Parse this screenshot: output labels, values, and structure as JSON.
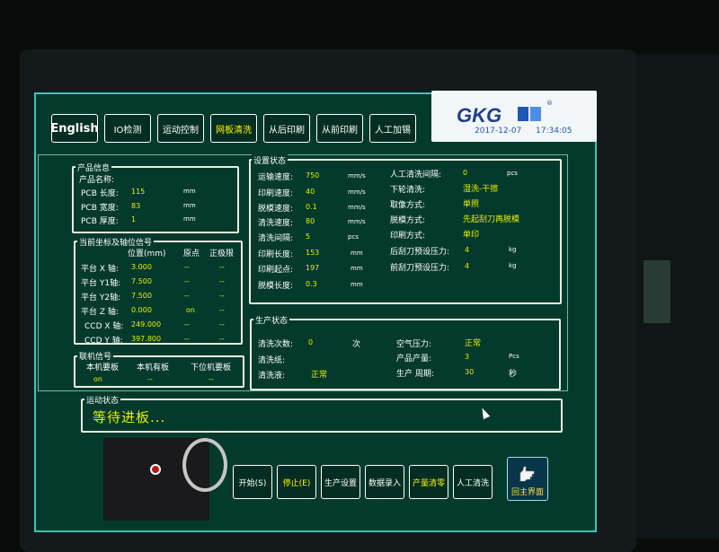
{
  "header": {
    "buttons": [
      {
        "label": "English"
      },
      {
        "label": "IO检测"
      },
      {
        "label": "运动控制"
      },
      {
        "label": "网板清洗"
      },
      {
        "label": "从后印刷"
      },
      {
        "label": "从前印刷"
      },
      {
        "label": "人工加锡"
      }
    ],
    "brand": {
      "name": "GKG",
      "reg": "®",
      "date": "2017-12-07",
      "time": "17:34:05"
    }
  },
  "product_info": {
    "title": "产品信息",
    "name_label": "产品名称:",
    "rows": [
      {
        "label": "PCB 长度:",
        "value": "115",
        "unit": "mm"
      },
      {
        "label": "PCB 宽度:",
        "value": "83",
        "unit": "mm"
      },
      {
        "label": "PCB 厚度:",
        "value": "1",
        "unit": "mm"
      }
    ]
  },
  "axis_status": {
    "title": "当前坐标及轴位信号",
    "headers": [
      "位置(mm)",
      "原点",
      "正极限"
    ],
    "rows": [
      {
        "label": "平台 X 轴:",
        "pos": "3.000",
        "origin": "--",
        "limit": "--"
      },
      {
        "label": "平台 Y1轴:",
        "pos": "7.500",
        "origin": "--",
        "limit": "--"
      },
      {
        "label": "平台 Y2轴:",
        "pos": "7.500",
        "origin": "--",
        "limit": "--"
      },
      {
        "label": "平台 Z 轴:",
        "pos": "0.000",
        "origin": "on",
        "limit": "--"
      },
      {
        "label": "CCD  X 轴:",
        "pos": "249.000",
        "origin": "--",
        "limit": "--"
      },
      {
        "label": "CCD  Y 轴:",
        "pos": "397.800",
        "origin": "--",
        "limit": "--"
      }
    ]
  },
  "link_signals": {
    "title": "联机信号",
    "headers": [
      "本机要板",
      "本机有板",
      "下位机要板"
    ],
    "values": [
      "on",
      "--",
      "--"
    ]
  },
  "settings": {
    "title": "设置状态",
    "left": [
      {
        "label": "运输速度:",
        "value": "750",
        "unit": "mm/s"
      },
      {
        "label": "印刷速度:",
        "value": "40",
        "unit": "mm/s"
      },
      {
        "label": "脱模速度:",
        "value": "0.1",
        "unit": "mm/s"
      },
      {
        "label": "清洗速度:",
        "value": "80",
        "unit": "mm/s"
      },
      {
        "label": "清洗间隔:",
        "value": "5",
        "unit": "pcs"
      },
      {
        "label": "印刷长度:",
        "value": "153",
        "unit": "mm"
      },
      {
        "label": "印刷起点:",
        "value": "197",
        "unit": "mm"
      },
      {
        "label": "脱模长度:",
        "value": "0.3",
        "unit": "mm"
      }
    ],
    "right": [
      {
        "label": "人工清洗间隔:",
        "value": "0",
        "unit": "pcs"
      },
      {
        "label": "下轮清洗:",
        "value": "湿洗-干擦",
        "unit": ""
      },
      {
        "label": "取像方式:",
        "value": "单照",
        "unit": ""
      },
      {
        "label": "脱模方式:",
        "value": "先起刮刀再脱模",
        "unit": ""
      },
      {
        "label": "印刷方式:",
        "value": "单印",
        "unit": ""
      },
      {
        "label": "后刮刀预设压力:",
        "value": "4",
        "unit": "kg"
      },
      {
        "label": "前刮刀预设压力:",
        "value": "4",
        "unit": "kg"
      }
    ]
  },
  "production": {
    "title": "生产状态",
    "clean_count_label": "清洗次数:",
    "clean_count_value": "0",
    "clean_count_unit": "次",
    "air_label": "空气压力:",
    "air_value": "正常",
    "paper_label": "清洗纸:",
    "output_label": "产品产量:",
    "output_value": "3",
    "output_unit": "Pcs",
    "liquid_label": "清洗液:",
    "liquid_value": "正常",
    "cycle_label": "生产 周期:",
    "cycle_value": "30",
    "cycle_unit": "秒"
  },
  "motion": {
    "title": "运动状态",
    "message": "等待进板..."
  },
  "bottom_bar": {
    "buttons": [
      {
        "label": "开始(S)"
      },
      {
        "label": "停止(E)"
      },
      {
        "label": "生产设置"
      },
      {
        "label": "数据录入"
      },
      {
        "label": "产量清零"
      },
      {
        "label": "人工清洗"
      }
    ],
    "home_label": "回主界面"
  },
  "colors": {
    "accent": "#e6f000",
    "panel_bg": "#043a2c",
    "border": "#39c6c0"
  }
}
